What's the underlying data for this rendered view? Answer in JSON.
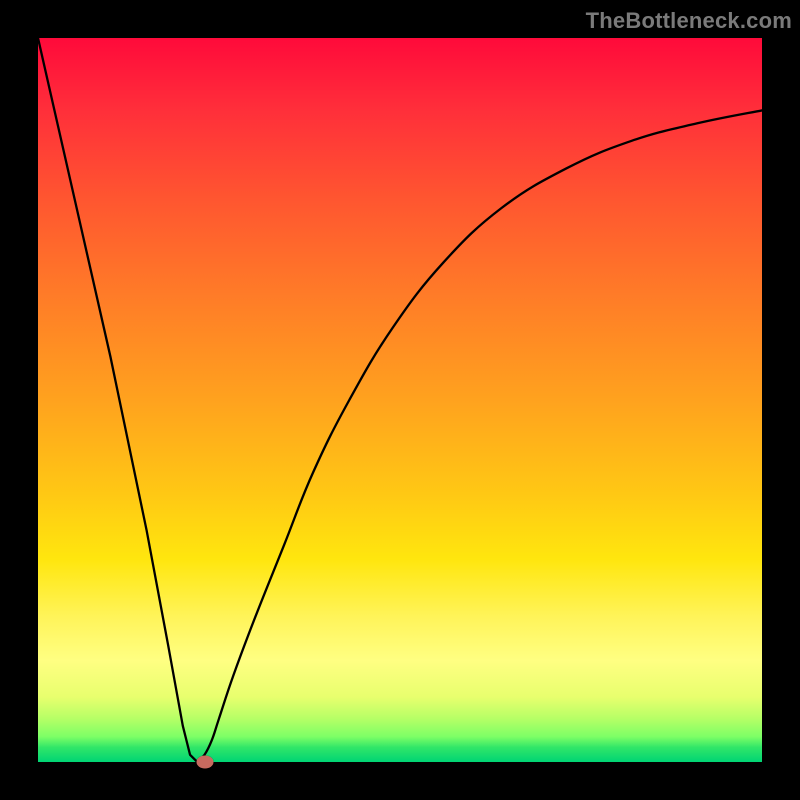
{
  "watermark": "TheBottleneck.com",
  "chart_data": {
    "type": "line",
    "title": "",
    "xlabel": "",
    "ylabel": "",
    "xlim": [
      0,
      100
    ],
    "ylim": [
      0,
      100
    ],
    "grid": false,
    "legend": false,
    "colors": {
      "curve": "#000000",
      "marker": "#c76a5f",
      "gradient_top": "#ff0a3a",
      "gradient_bottom": "#00d474"
    },
    "series": [
      {
        "name": "bottleneck_curve",
        "x": [
          0,
          5,
          10,
          15,
          18,
          20,
          21,
          22,
          23,
          24,
          25,
          27,
          30,
          34,
          38,
          43,
          49,
          56,
          64,
          73,
          82,
          91,
          100
        ],
        "y": [
          100,
          78,
          56,
          32,
          16,
          5,
          1,
          0,
          1,
          3,
          6,
          12,
          20,
          30,
          40,
          50,
          60,
          69,
          76.5,
          82,
          85.8,
          88.2,
          90
        ]
      }
    ],
    "min_point": {
      "x": 22,
      "y": 0
    },
    "marker": {
      "x": 23,
      "y": 0
    }
  }
}
